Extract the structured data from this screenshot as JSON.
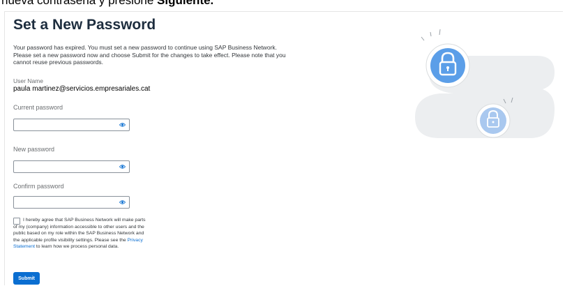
{
  "caption": {
    "prefix": "nueva contraseña y presione ",
    "bold": "Siguiente."
  },
  "page": {
    "title": "Set a New Password",
    "intro_lines": [
      "Your password has expired. You must set a new password to continue using SAP Business Network.",
      "Please set a new password now and choose Submit for the changes to take effect. Please note that you",
      "cannot reuse previous passwords."
    ]
  },
  "user": {
    "label": "User Name",
    "value": "paula martinez@servicios.empresariales.cat"
  },
  "fields": {
    "current": {
      "label": "Current password",
      "value": ""
    },
    "new": {
      "label": "New password",
      "value": ""
    },
    "confirm": {
      "label": "Confirm password",
      "value": ""
    }
  },
  "agreement": {
    "checked": false,
    "line1": "I hereby agree that SAP Business Network will make parts",
    "line2": "of my (company) information accessible to other users and the",
    "line3": "public based on my role within the SAP Business Network and",
    "line4_prefix": "the applicable profile visibility settings. Please see the ",
    "link1": "Privacy",
    "link2": "Statement",
    "line5_suffix": " to learn how we process personal data."
  },
  "actions": {
    "submit_label": "Submit"
  },
  "colors": {
    "accent": "#0a6ed1",
    "illustration_blue": "#5b9ee8",
    "illustration_gray": "#eceef0"
  },
  "icons": [
    "eye-icon",
    "lock-icon"
  ]
}
